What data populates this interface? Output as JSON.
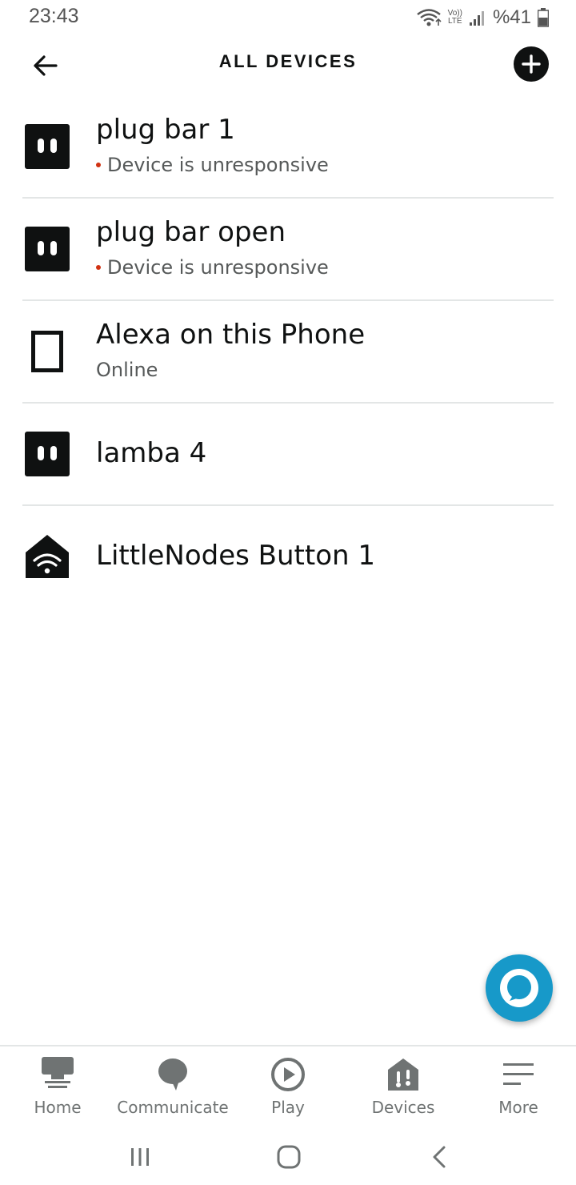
{
  "status_bar": {
    "time": "23:43",
    "volte_top": "Vo))",
    "volte_bottom": "LTE",
    "battery": "%41"
  },
  "header": {
    "title": "ALL DEVICES",
    "back_icon": "arrow-left-icon",
    "add_icon": "plus-circle-icon"
  },
  "devices": [
    {
      "name": "plug bar 1",
      "status": "Device is unresponsive",
      "icon": "plug-icon",
      "status_color": "#d13212"
    },
    {
      "name": "plug bar open",
      "status": "Device is unresponsive",
      "icon": "plug-icon",
      "status_color": "#d13212"
    },
    {
      "name": "Alexa on this Phone",
      "status": "Online",
      "icon": "phone-icon"
    },
    {
      "name": "lamba 4",
      "status": "",
      "icon": "plug-icon"
    },
    {
      "name": "LittleNodes Button 1",
      "status": "",
      "icon": "wifi-home-icon"
    }
  ],
  "bottom_nav": [
    {
      "label": "Home",
      "icon": "home-icon"
    },
    {
      "label": "Communicate",
      "icon": "chat-bubble-icon"
    },
    {
      "label": "Play",
      "icon": "play-icon"
    },
    {
      "label": "Devices",
      "icon": "devices-icon"
    },
    {
      "label": "More",
      "icon": "menu-icon"
    }
  ],
  "colors": {
    "accent": "#1799c9",
    "text": "#0f1111",
    "secondary_text": "#565959",
    "error": "#d13212"
  }
}
